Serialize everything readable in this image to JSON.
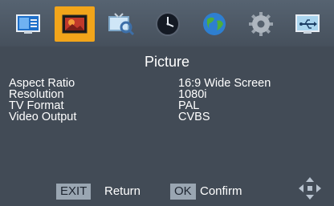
{
  "menu": {
    "tabs": [
      {
        "icon": "display-monitor-icon",
        "active": false
      },
      {
        "icon": "picture-icon",
        "active": true
      },
      {
        "icon": "tv-search-icon",
        "active": false
      },
      {
        "icon": "clock-icon",
        "active": false
      },
      {
        "icon": "globe-icon",
        "active": false
      },
      {
        "icon": "settings-gear-icon",
        "active": false
      },
      {
        "icon": "usb-icon",
        "active": false
      }
    ],
    "title": "Picture",
    "settings": [
      {
        "label": "Aspect Ratio",
        "value": "16:9 Wide Screen"
      },
      {
        "label": "Resolution",
        "value": "1080i"
      },
      {
        "label": "TV Format",
        "value": "PAL"
      },
      {
        "label": "Video Output",
        "value": "CVBS"
      }
    ],
    "footer": {
      "exit_key": "EXIT",
      "exit_action": "Return",
      "ok_key": "OK",
      "ok_action": "Confirm",
      "nav_icon": "four-way-arrows-icon"
    },
    "colors": {
      "background": "#424b56",
      "active_tab": "#f2a51a",
      "key_badge": "#9aa6b2",
      "text": "#ffffff"
    }
  }
}
